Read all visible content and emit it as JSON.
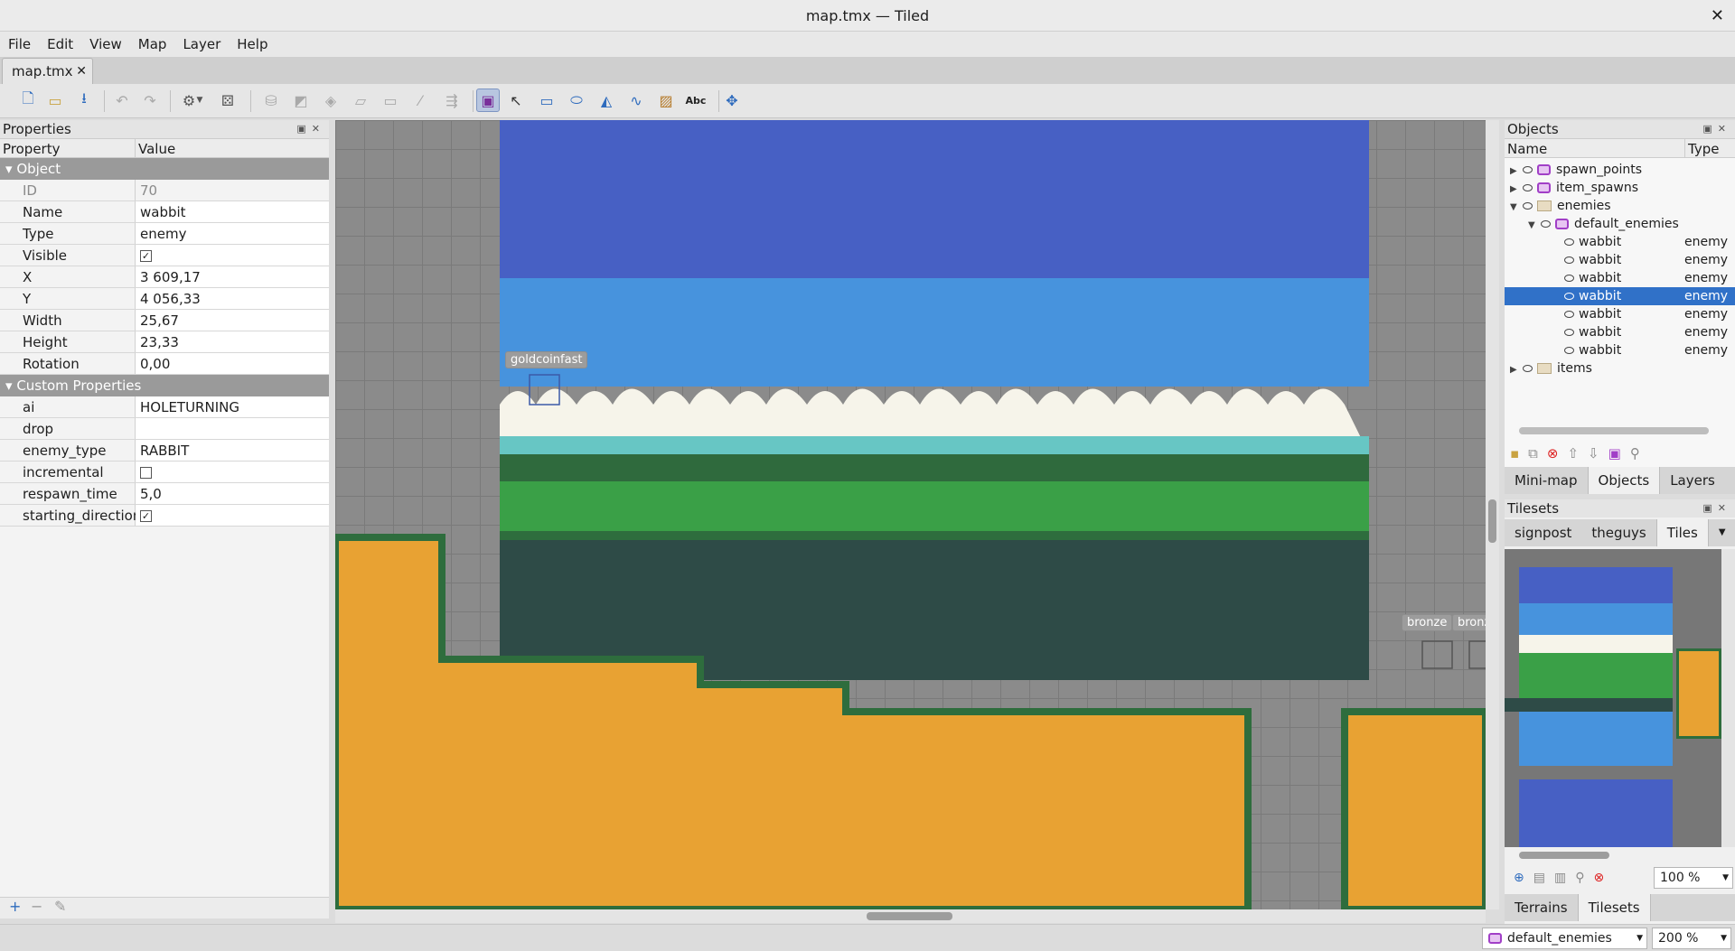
{
  "window": {
    "title": "map.tmx — Tiled"
  },
  "menu": [
    "File",
    "Edit",
    "View",
    "Map",
    "Layer",
    "Help"
  ],
  "document_tab": {
    "label": "map.tmx"
  },
  "properties": {
    "title": "Properties",
    "col_property": "Property",
    "col_value": "Value",
    "object_group": "Object",
    "custom_group": "Custom Properties",
    "rows": [
      {
        "k": "ID",
        "v": "70"
      },
      {
        "k": "Name",
        "v": "wabbit"
      },
      {
        "k": "Type",
        "v": "enemy"
      },
      {
        "k": "Visible",
        "v": "✓"
      },
      {
        "k": "X",
        "v": "3 609,17"
      },
      {
        "k": "Y",
        "v": "4 056,33"
      },
      {
        "k": "Width",
        "v": "25,67"
      },
      {
        "k": "Height",
        "v": "23,33"
      },
      {
        "k": "Rotation",
        "v": "0,00"
      }
    ],
    "custom_rows": [
      {
        "k": "ai",
        "v": "HOLETURNING"
      },
      {
        "k": "drop",
        "v": ""
      },
      {
        "k": "enemy_type",
        "v": "RABBIT"
      },
      {
        "k": "incremental",
        "v": ""
      },
      {
        "k": "respawn_time",
        "v": "5,0"
      },
      {
        "k": "starting_direction",
        "v": "✓"
      }
    ]
  },
  "canvas": {
    "label_goldcoin": "goldcoinfast",
    "label_bronze1": "bronze",
    "label_bronze2": "bronz"
  },
  "objects_panel": {
    "title": "Objects",
    "col_name": "Name",
    "col_type": "Type",
    "items": [
      {
        "name": "spawn_points",
        "type": ""
      },
      {
        "name": "item_spawns",
        "type": ""
      },
      {
        "name": "enemies",
        "type": ""
      },
      {
        "name": "default_enemies",
        "type": ""
      },
      {
        "name": "wabbit",
        "type": "enemy"
      },
      {
        "name": "wabbit",
        "type": "enemy"
      },
      {
        "name": "wabbit",
        "type": "enemy"
      },
      {
        "name": "wabbit",
        "type": "enemy"
      },
      {
        "name": "wabbit",
        "type": "enemy"
      },
      {
        "name": "wabbit",
        "type": "enemy"
      },
      {
        "name": "wabbit",
        "type": "enemy"
      },
      {
        "name": "items",
        "type": ""
      }
    ],
    "tabs": [
      "Mini-map",
      "Objects",
      "Layers"
    ]
  },
  "tilesets_panel": {
    "title": "Tilesets",
    "tabs": [
      "signpost",
      "theguys",
      "Tiles"
    ],
    "zoom": "100 %",
    "bottom_tabs": [
      "Terrains",
      "Tilesets"
    ]
  },
  "status": {
    "layer": "default_enemies",
    "zoom": "200 %"
  },
  "colors": {
    "selection": "#3071c8",
    "sky": "#4760c4",
    "ground": "#e8a233"
  }
}
